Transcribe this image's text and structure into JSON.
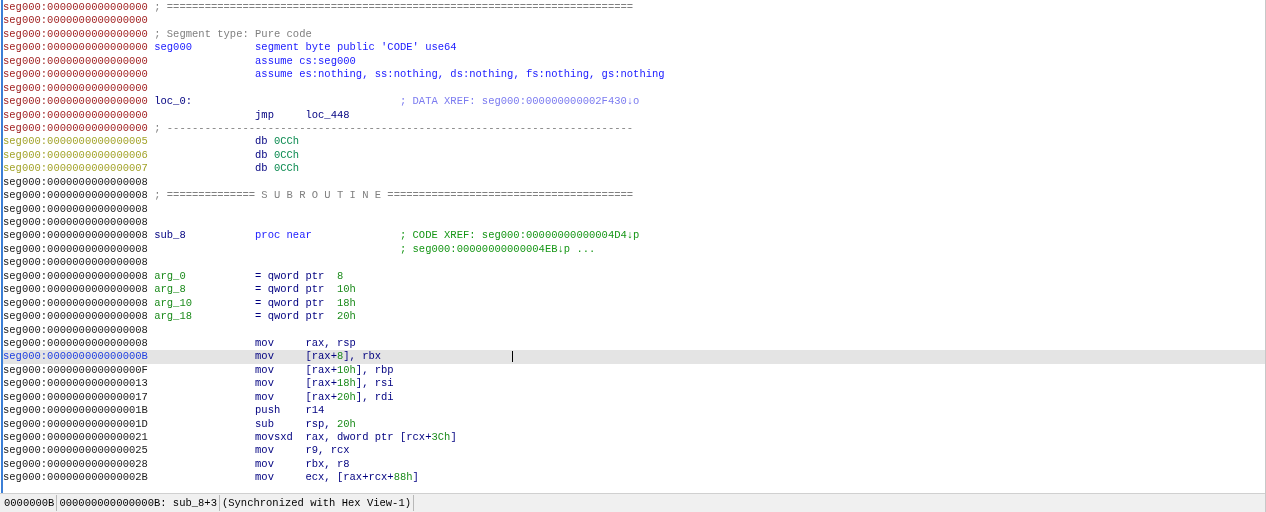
{
  "listing": {
    "rows": [
      {
        "address": "seg000:0000000000000000",
        "kind": "head",
        "selected": false,
        "comment": {
          "kind": "rule",
          "text": "; =========================================================================="
        }
      },
      {
        "address": "seg000:0000000000000000",
        "kind": "head",
        "selected": false
      },
      {
        "address": "seg000:0000000000000000",
        "kind": "head",
        "selected": false,
        "comment": {
          "kind": "note",
          "text": "; Segment type: Pure code"
        }
      },
      {
        "address": "seg000:0000000000000000",
        "kind": "head",
        "selected": false,
        "label": {
          "kind": "segment",
          "text": "seg000"
        },
        "directive": {
          "keyword": "segment",
          "text": "byte public 'CODE' use64"
        }
      },
      {
        "address": "seg000:0000000000000000",
        "kind": "head",
        "selected": false,
        "directive": {
          "keyword": "assume",
          "text": "cs:seg000"
        }
      },
      {
        "address": "seg000:0000000000000000",
        "kind": "head",
        "selected": false,
        "directive": {
          "keyword": "assume",
          "text": "es:nothing, ss:nothing, ds:nothing, fs:nothing, gs:nothing"
        }
      },
      {
        "address": "seg000:0000000000000000",
        "kind": "head",
        "selected": false
      },
      {
        "address": "seg000:0000000000000000",
        "kind": "head",
        "selected": false,
        "label": {
          "kind": "code",
          "text": "loc_0:"
        },
        "comment": {
          "kind": "data_xref",
          "text": "; DATA XREF: seg000:000000000002F430↓o"
        }
      },
      {
        "address": "seg000:0000000000000000",
        "kind": "head",
        "selected": false,
        "insn": {
          "mnemonic": "jmp",
          "operands": [
            {
              "kind": "reg",
              "text": "loc_448"
            }
          ]
        }
      },
      {
        "address": "seg000:0000000000000000",
        "kind": "head",
        "selected": false,
        "comment": {
          "kind": "rule",
          "text": "; --------------------------------------------------------------------------"
        }
      },
      {
        "address": "seg000:0000000000000005",
        "kind": "data",
        "selected": false,
        "directive": {
          "keyword": "db",
          "value": "0CCh"
        }
      },
      {
        "address": "seg000:0000000000000006",
        "kind": "data",
        "selected": false,
        "directive": {
          "keyword": "db",
          "value": "0CCh"
        }
      },
      {
        "address": "seg000:0000000000000007",
        "kind": "data",
        "selected": false,
        "directive": {
          "keyword": "db",
          "value": "0CCh"
        }
      },
      {
        "address": "seg000:0000000000000008",
        "kind": "code",
        "selected": false
      },
      {
        "address": "seg000:0000000000000008",
        "kind": "code",
        "selected": false,
        "comment": {
          "kind": "note",
          "text": "; ============== S U B R O U T I N E ======================================="
        }
      },
      {
        "address": "seg000:0000000000000008",
        "kind": "code",
        "selected": false
      },
      {
        "address": "seg000:0000000000000008",
        "kind": "code",
        "selected": false
      },
      {
        "address": "seg000:0000000000000008",
        "kind": "code",
        "selected": false,
        "label": {
          "kind": "code",
          "text": "sub_8"
        },
        "directive": {
          "keyword": "proc",
          "text": "near"
        },
        "comment": {
          "kind": "code_xref",
          "text": "; CODE XREF: seg000:00000000000004D4↓p"
        }
      },
      {
        "address": "seg000:0000000000000008",
        "kind": "code",
        "selected": false,
        "comment": {
          "kind": "code_xref",
          "text": "; seg000:00000000000004EB↓p ..."
        }
      },
      {
        "address": "seg000:0000000000000008",
        "kind": "code",
        "selected": false
      },
      {
        "address": "seg000:0000000000000008",
        "kind": "code",
        "selected": false,
        "label": {
          "kind": "arg",
          "text": "arg_0"
        },
        "directive": {
          "keyword": "=",
          "text": "qword ptr",
          "value": "8"
        }
      },
      {
        "address": "seg000:0000000000000008",
        "kind": "code",
        "selected": false,
        "label": {
          "kind": "arg",
          "text": "arg_8"
        },
        "directive": {
          "keyword": "=",
          "text": "qword ptr",
          "value": "10h"
        }
      },
      {
        "address": "seg000:0000000000000008",
        "kind": "code",
        "selected": false,
        "label": {
          "kind": "arg",
          "text": "arg_10"
        },
        "directive": {
          "keyword": "=",
          "text": "qword ptr",
          "value": "18h"
        }
      },
      {
        "address": "seg000:0000000000000008",
        "kind": "code",
        "selected": false,
        "label": {
          "kind": "arg",
          "text": "arg_18"
        },
        "directive": {
          "keyword": "=",
          "text": "qword ptr",
          "value": "20h"
        }
      },
      {
        "address": "seg000:0000000000000008",
        "kind": "code",
        "selected": false
      },
      {
        "address": "seg000:0000000000000008",
        "kind": "code",
        "selected": false,
        "insn": {
          "mnemonic": "mov",
          "operands": [
            {
              "kind": "reg",
              "text": "rax, rsp"
            }
          ]
        }
      },
      {
        "address": "seg000:000000000000000B",
        "kind": "code",
        "selected": true,
        "insn": {
          "mnemonic": "mov",
          "operands": [
            {
              "kind": "reg",
              "text": "[rax+"
            },
            {
              "kind": "num",
              "text": "8"
            },
            {
              "kind": "reg",
              "text": "], rbx"
            }
          ]
        }
      },
      {
        "address": "seg000:000000000000000F",
        "kind": "code",
        "selected": false,
        "insn": {
          "mnemonic": "mov",
          "operands": [
            {
              "kind": "reg",
              "text": "[rax+"
            },
            {
              "kind": "num",
              "text": "10h"
            },
            {
              "kind": "reg",
              "text": "], rbp"
            }
          ]
        }
      },
      {
        "address": "seg000:0000000000000013",
        "kind": "code",
        "selected": false,
        "insn": {
          "mnemonic": "mov",
          "operands": [
            {
              "kind": "reg",
              "text": "[rax+"
            },
            {
              "kind": "num",
              "text": "18h"
            },
            {
              "kind": "reg",
              "text": "], rsi"
            }
          ]
        }
      },
      {
        "address": "seg000:0000000000000017",
        "kind": "code",
        "selected": false,
        "insn": {
          "mnemonic": "mov",
          "operands": [
            {
              "kind": "reg",
              "text": "[rax+"
            },
            {
              "kind": "num",
              "text": "20h"
            },
            {
              "kind": "reg",
              "text": "], rdi"
            }
          ]
        }
      },
      {
        "address": "seg000:000000000000001B",
        "kind": "code",
        "selected": false,
        "insn": {
          "mnemonic": "push",
          "operands": [
            {
              "kind": "reg",
              "text": "r14"
            }
          ]
        }
      },
      {
        "address": "seg000:000000000000001D",
        "kind": "code",
        "selected": false,
        "insn": {
          "mnemonic": "sub",
          "operands": [
            {
              "kind": "reg",
              "text": "rsp, "
            },
            {
              "kind": "num",
              "text": "20h"
            }
          ]
        }
      },
      {
        "address": "seg000:0000000000000021",
        "kind": "code",
        "selected": false,
        "insn": {
          "mnemonic": "movsxd",
          "operands": [
            {
              "kind": "reg",
              "text": "rax, dword ptr [rcx+"
            },
            {
              "kind": "num",
              "text": "3Ch"
            },
            {
              "kind": "reg",
              "text": "]"
            }
          ]
        }
      },
      {
        "address": "seg000:0000000000000025",
        "kind": "code",
        "selected": false,
        "insn": {
          "mnemonic": "mov",
          "operands": [
            {
              "kind": "reg",
              "text": "r9, rcx"
            }
          ]
        }
      },
      {
        "address": "seg000:0000000000000028",
        "kind": "code",
        "selected": false,
        "insn": {
          "mnemonic": "mov",
          "operands": [
            {
              "kind": "reg",
              "text": "rbx, r8"
            }
          ]
        }
      },
      {
        "address": "seg000:000000000000002B",
        "kind": "code",
        "selected": false,
        "insn": {
          "mnemonic": "mov",
          "operands": [
            {
              "kind": "reg",
              "text": "ecx, [rax+rcx+"
            },
            {
              "kind": "num",
              "text": "88h"
            },
            {
              "kind": "reg",
              "text": "]"
            }
          ]
        }
      }
    ]
  },
  "status_bar": [
    "0000000B",
    "000000000000000B: sub_8+3",
    "(Synchronized with Hex View-1)"
  ]
}
